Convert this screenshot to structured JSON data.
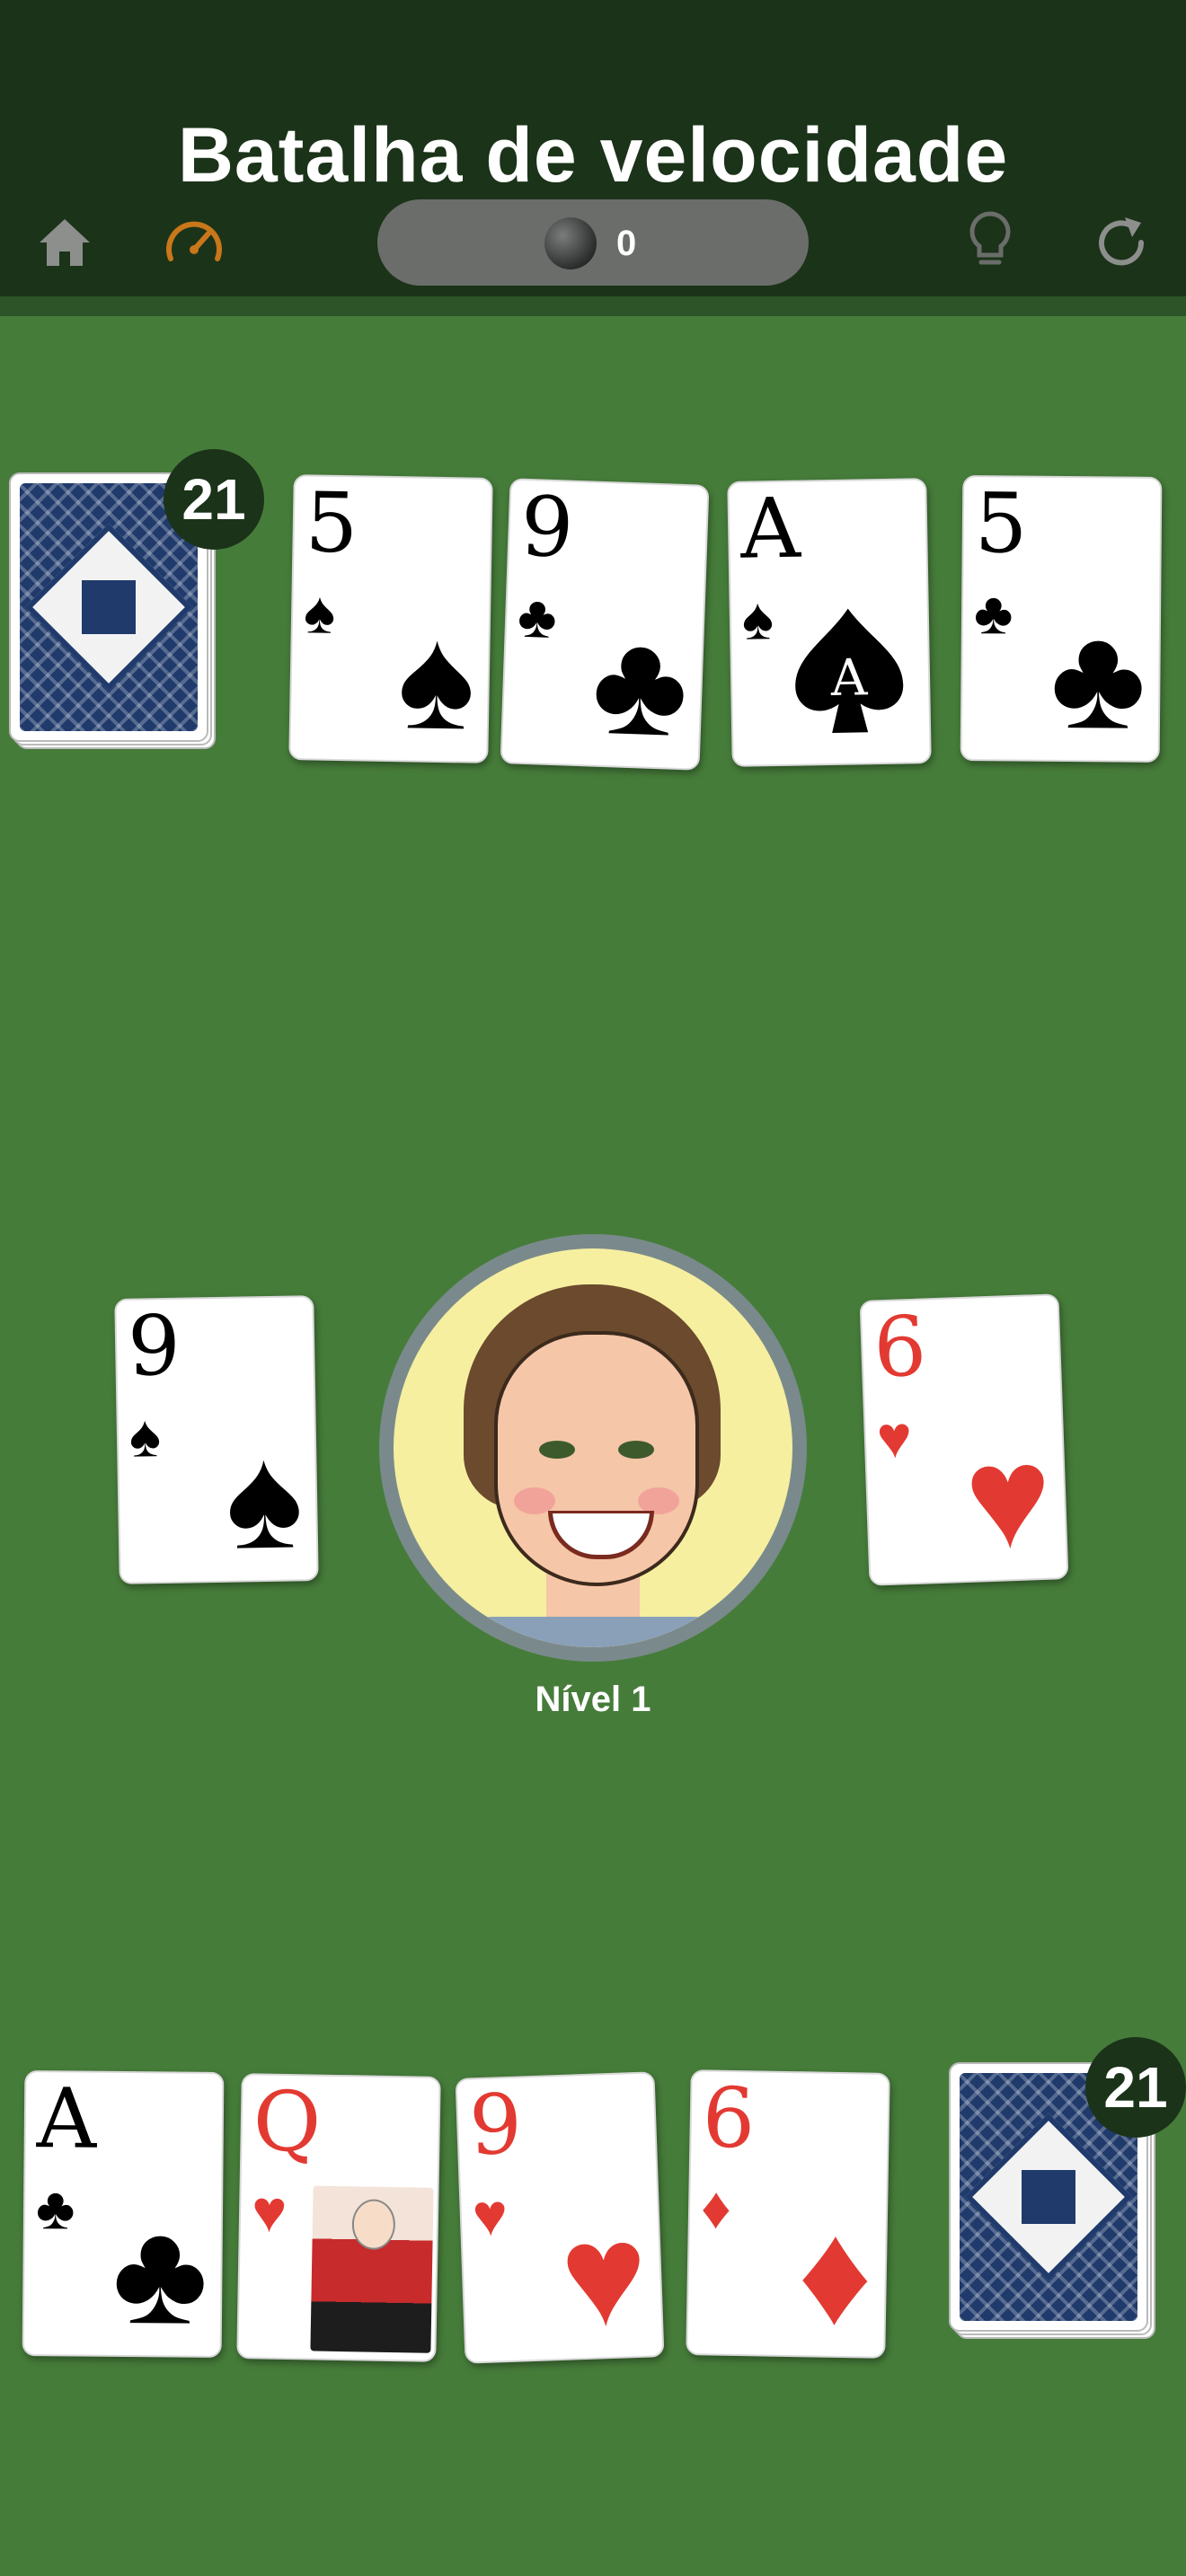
{
  "header": {
    "title": "Batalha de velocidade",
    "icons": [
      "home-icon",
      "speedometer-icon",
      "lightbulb-icon",
      "restart-icon"
    ],
    "coins": "0"
  },
  "opponent": {
    "deck_count": "21",
    "cards": [
      {
        "rank": "5",
        "suit": "♠"
      },
      {
        "rank": "9",
        "suit": "♣"
      },
      {
        "rank": "A",
        "suit": "♠"
      },
      {
        "rank": "5",
        "suit": "♣"
      }
    ]
  },
  "center": {
    "left_pile": {
      "rank": "9",
      "suit": "♠"
    },
    "right_pile": {
      "rank": "6",
      "suit": "♥"
    },
    "level": "Nível 1"
  },
  "player": {
    "deck_count": "21",
    "cards": [
      {
        "rank": "A",
        "suit": "♣"
      },
      {
        "rank": "Q",
        "suit": "♥"
      },
      {
        "rank": "9",
        "suit": "♥"
      },
      {
        "rank": "6",
        "suit": "♦"
      }
    ]
  },
  "colors": {
    "table_green": "#467c3a",
    "header_dark": "#1b3319",
    "red_suit": "#e23a32",
    "gauge_orange": "#c8771a"
  }
}
